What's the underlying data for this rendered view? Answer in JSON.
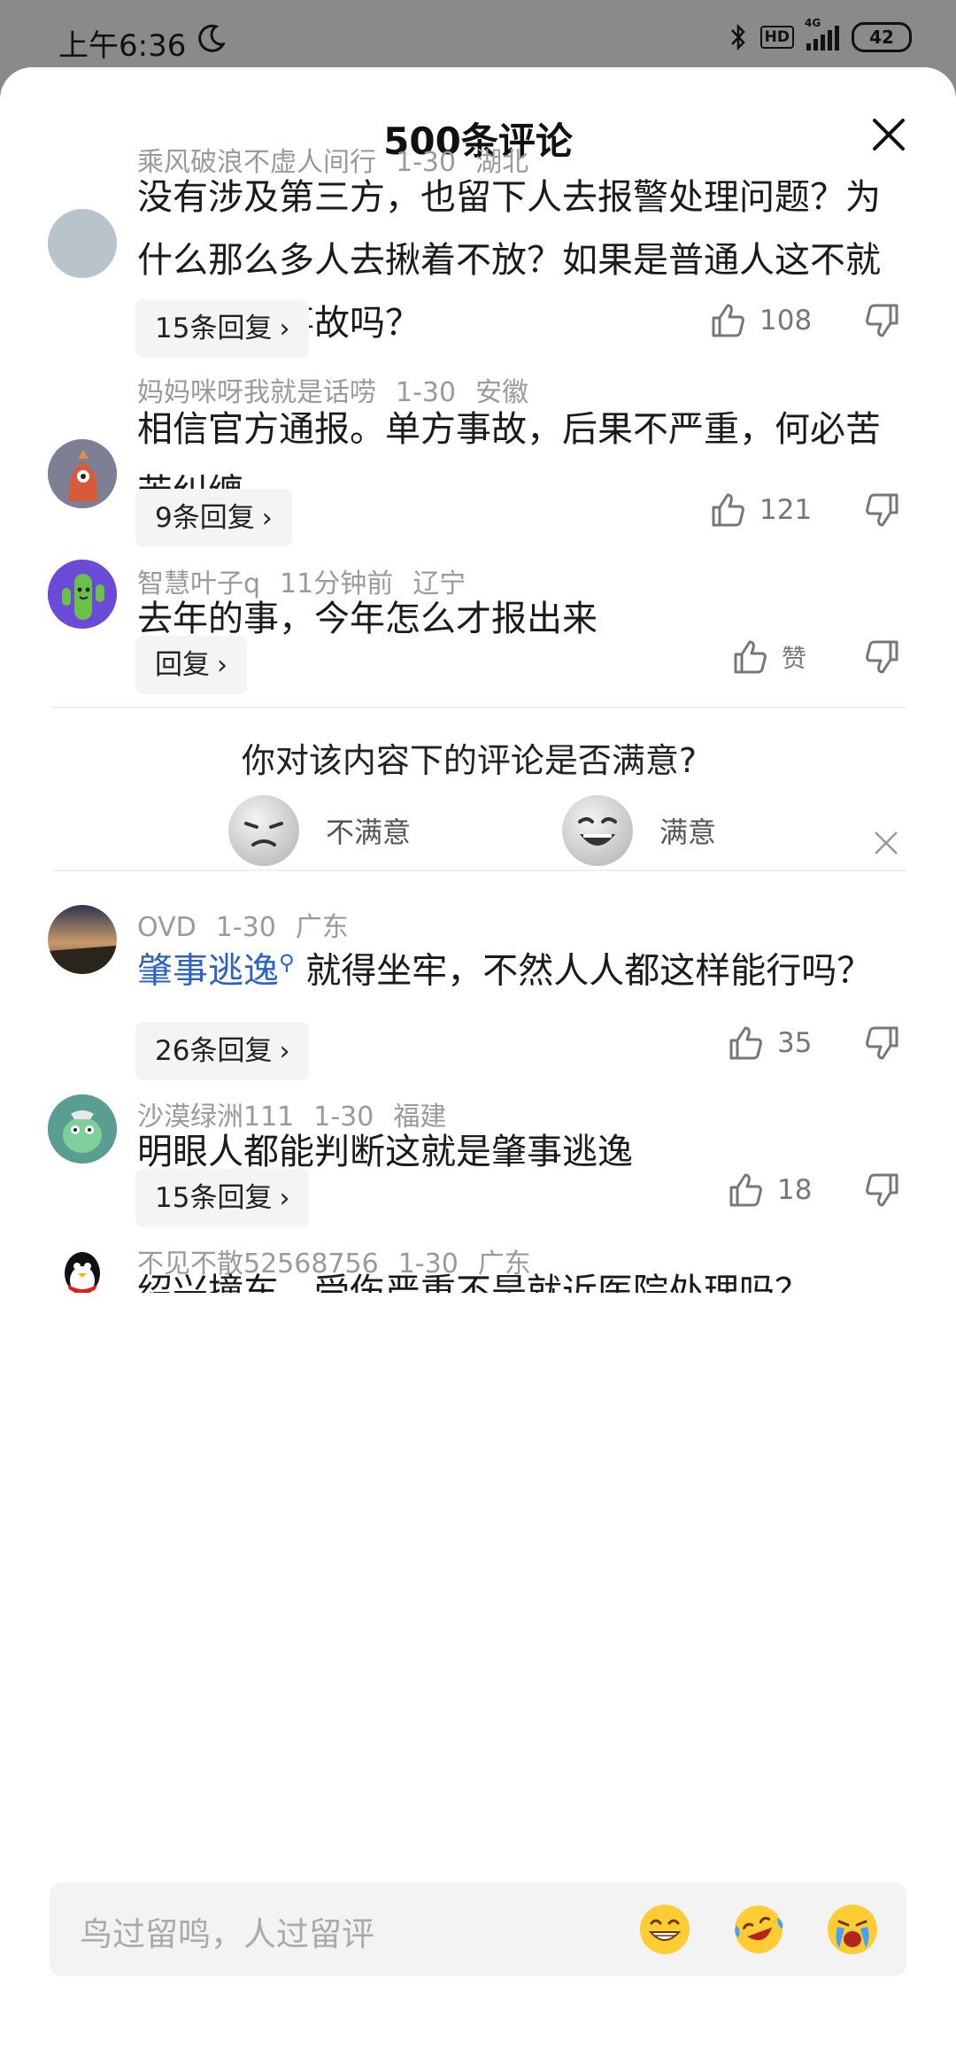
{
  "status_bar": {
    "time": "上午6:36",
    "hd": "HD",
    "network": "4G",
    "battery": "42"
  },
  "sheet": {
    "title": "500条评论"
  },
  "comments": [
    {
      "username": "乘风破浪不虚人间行",
      "date": "1-30",
      "location": "湖北",
      "text": "没有涉及第三方，也留下人去报警处理问题？为什么那么多人去揪着不放？如果是普通人这不就是一起小事故吗？",
      "replies": "15条回复",
      "likes": "108"
    },
    {
      "username": "妈妈咪呀我就是话唠",
      "date": "1-30",
      "location": "安徽",
      "text": "相信官方通报。单方事故，后果不严重，何必苦苦纠缠",
      "replies": "9条回复",
      "likes": "121"
    },
    {
      "username": "智慧叶子q",
      "date": "11分钟前",
      "location": "辽宁",
      "text": "去年的事，今年怎么才报出来",
      "replies": "回复",
      "likes": "赞"
    },
    {
      "username": "OVD",
      "date": "1-30",
      "location": "广东",
      "text_link": "肇事逃逸",
      "text": "就得坐牢，不然人人都这样能行吗？",
      "replies": "26条回复",
      "likes": "35"
    },
    {
      "username": "沙漠绿洲111",
      "date": "1-30",
      "location": "福建",
      "text": "明眼人都能判断这就是肇事逃逸",
      "replies": "15条回复",
      "likes": "18"
    },
    {
      "username": "不见不散52568756",
      "date": "1-30",
      "location": "广东",
      "text": "绍兴撞车，受伤严重不是就近医院处理吗？"
    }
  ],
  "survey": {
    "question": "你对该内容下的评论是否满意?",
    "option_unsatisfied": "不满意",
    "option_satisfied": "满意"
  },
  "input": {
    "placeholder": "鸟过留鸣，人过留评",
    "emojis": [
      "grin-emoji-icon",
      "laugh-cry-emoji-icon",
      "crying-emoji-icon"
    ]
  },
  "colors": {
    "link": "#2b62c5",
    "meta": "#9a9a9a",
    "status_bar_bg": "#8a8a8a"
  }
}
